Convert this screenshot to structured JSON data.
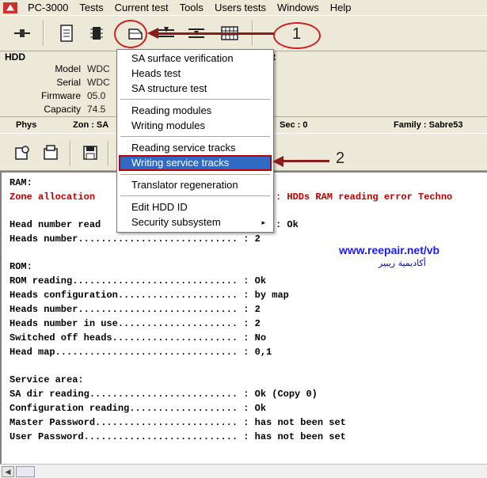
{
  "menubar": {
    "items": [
      "PC-3000",
      "Tests",
      "Current test",
      "Tools",
      "Users tests",
      "Windows",
      "Help"
    ]
  },
  "hdd": {
    "title": "HDD",
    "labels": [
      "Model",
      "Serial",
      "Firmware",
      "Capacity"
    ],
    "values": [
      "WDC",
      "WDC",
      "05.0",
      "74.5"
    ],
    "extra": "t"
  },
  "status": {
    "phys": "Phys",
    "zone": "Zon : SA",
    "sec": "Sec : 0",
    "family": "Family : Sabre53"
  },
  "dropdown": {
    "items": [
      "SA surface verification",
      "Heads test",
      "SA structure test",
      "Reading modules",
      "Writing modules",
      "Reading service tracks",
      "Writing service tracks",
      "Translator regeneration",
      "Edit HDD ID",
      "Security subsystem"
    ],
    "submenu_arrow": "▸"
  },
  "annotations": {
    "one": "1",
    "two": "2"
  },
  "log": {
    "lines": [
      "RAM:",
      "Zone allocation",
      ": HDDs RAM reading error Techno",
      "Head number read",
      ": Ok",
      "Heads number............................ : 2",
      "",
      "ROM:",
      "ROM reading............................. : Ok",
      "Heads configuration..................... : by map",
      "Heads number............................ : 2",
      "Heads number in use..................... : 2",
      "Switched off heads...................... : No",
      "Head map................................ : 0,1",
      "",
      "Service area:",
      "SA dir reading.......................... : Ok (Copy 0)",
      "Configuration reading................... : Ok",
      "Master Password......................... : has not been set",
      "User Password........................... : has not been set"
    ]
  },
  "watermark": {
    "url": "www.reepair.net/vb",
    "arabic": "أكاديمية ريبير"
  },
  "icons": {
    "toolbar1": [
      "connect-icon",
      "info-icon",
      "chip-icon",
      "tests-icon",
      "heads-icon",
      "tracks-icon",
      "grid-icon"
    ],
    "toolbar2": [
      "settings-icon",
      "load-icon",
      "save-icon"
    ]
  },
  "colors": {
    "highlight": "#316ac5",
    "annotation": "#8b1c1c",
    "error_text": "#c00000",
    "watermark": "#1a1aff"
  }
}
